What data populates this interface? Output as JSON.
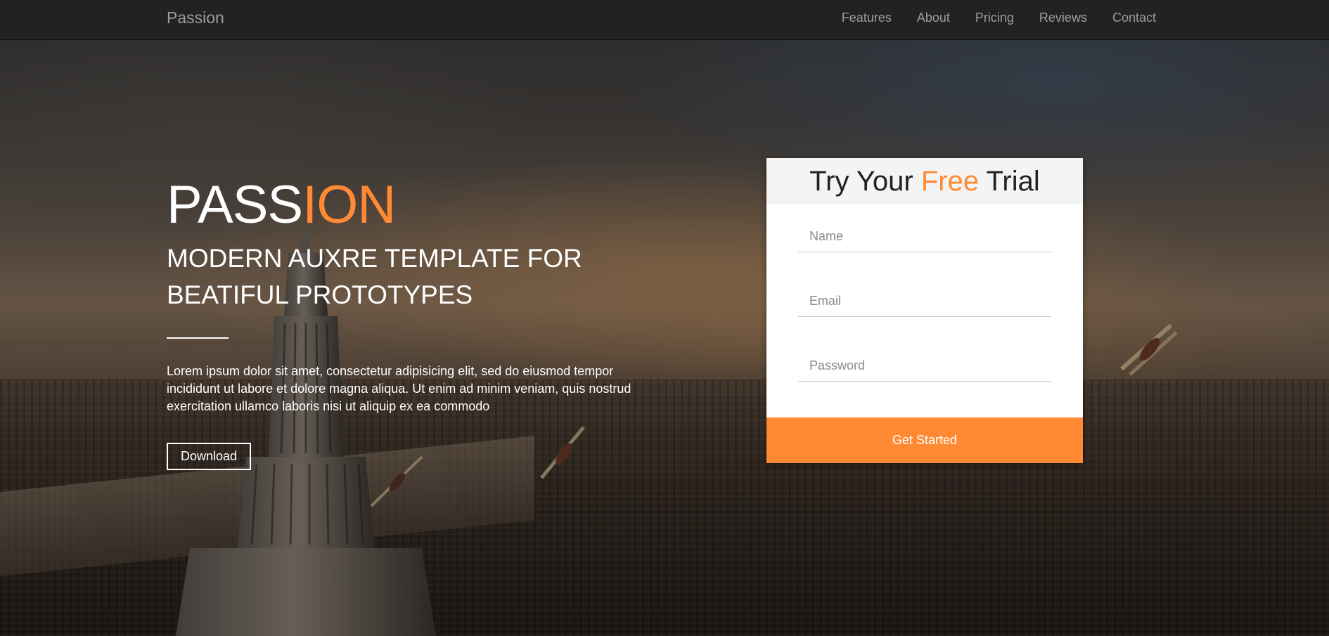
{
  "colors": {
    "accent": "#ff8a33",
    "navbar_bg": "#222222",
    "nav_text": "#9d9d9d"
  },
  "navbar": {
    "brand": "Passion",
    "links": [
      {
        "label": "Features"
      },
      {
        "label": "About"
      },
      {
        "label": "Pricing"
      },
      {
        "label": "Reviews"
      },
      {
        "label": "Contact"
      }
    ]
  },
  "hero": {
    "title_main": "PASS",
    "title_accent": "ION",
    "subtitle": "MODERN AUXRE TEMPLATE FOR BEATIFUL PROTOTYPES",
    "copy": "Lorem ipsum dolor sit amet, consectetur adipisicing elit, sed do eiusmod tempor incididunt ut labore et dolore magna aliqua. Ut enim ad minim veniam, quis nostrud exercitation ullamco laboris nisi ut aliquip ex ea commodo",
    "download_label": "Download"
  },
  "trial": {
    "title_before": "Try Your ",
    "title_accent": "Free",
    "title_after": " Trial",
    "name_placeholder": "Name",
    "email_placeholder": "Email",
    "password_placeholder": "Password",
    "submit_label": "Get Started"
  }
}
